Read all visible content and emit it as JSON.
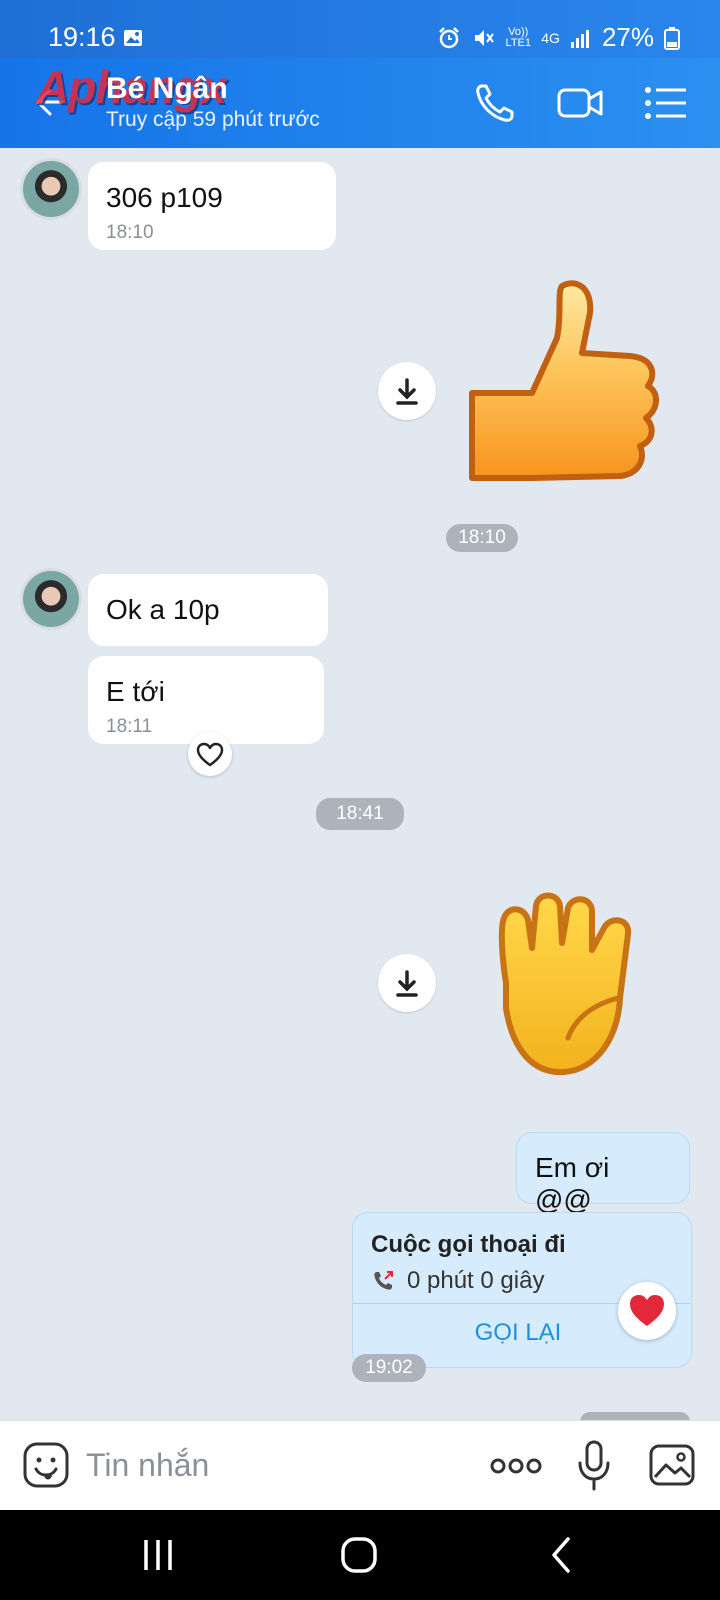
{
  "status_bar": {
    "time": "19:16",
    "battery": "27%",
    "network": "4G",
    "volte": "Vo)) LTE1"
  },
  "header": {
    "watermark": "Aphangx",
    "contact_name": "Bé Ngân",
    "last_seen": "Truy cập 59 phút trước"
  },
  "messages": {
    "m1_text": "306 p109",
    "m1_time": "18:10",
    "sticker1_time": "18:10",
    "m2_text": "Ok a 10p",
    "m3_text": "E tới",
    "m3_time": "18:11",
    "divider_time": "18:41",
    "m4_text": "Em ơi @@",
    "call_title": "Cuộc gọi thoại đi",
    "call_duration": "0 phút 0 giây",
    "call_action": "GỌI LẠI",
    "call_time": "19:02"
  },
  "composer": {
    "placeholder": "Tin nhắn"
  },
  "colors": {
    "header": "#1c7fe9",
    "mine_bubble": "#d6ecfd",
    "background": "#e2e8f0",
    "accent": "#1f8fe0",
    "heart": "#e3283c"
  }
}
